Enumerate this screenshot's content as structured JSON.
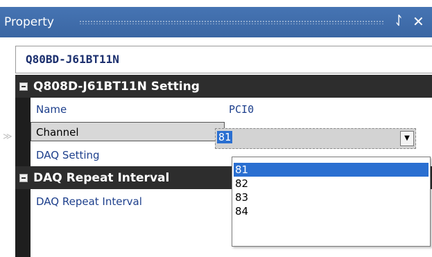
{
  "title_bar": {
    "title": "Property",
    "pin_glyph": "ᛇ",
    "close_glyph": "✕"
  },
  "object_selector": {
    "value": "Q80BD-J61BT11N"
  },
  "categories": [
    {
      "label": "Q808D-J61BT11N Setting",
      "properties": [
        {
          "name": "Name",
          "value": "PCI0"
        },
        {
          "name": "Channel",
          "value": "81"
        },
        {
          "name": "DAQ Setting",
          "value": ""
        }
      ]
    },
    {
      "label": "DAQ Repeat Interval",
      "properties": [
        {
          "name": "DAQ Repeat Interval",
          "value": ""
        }
      ]
    }
  ],
  "channel_dropdown": {
    "selected": "81",
    "options": [
      "81",
      "82",
      "83",
      "84"
    ]
  },
  "colors": {
    "title_bar": "#3c6aa8",
    "category_bg": "#2d2d2d",
    "selection": "#2a6fd1",
    "property_text": "#1d3f8c"
  },
  "icons": {
    "pin": "pin-icon",
    "close": "close-icon",
    "collapse": "collapse-icon",
    "dropdown": "chevron-down-icon",
    "row_marker": "selected-row-marker-icon"
  }
}
